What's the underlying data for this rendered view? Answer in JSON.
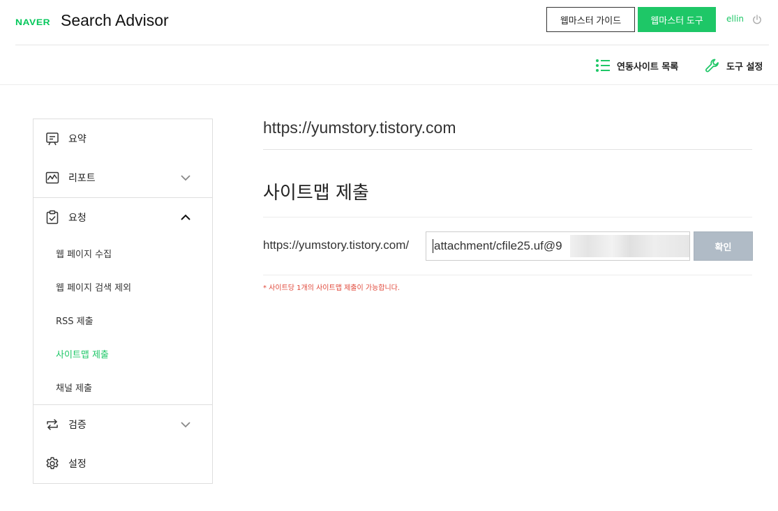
{
  "header": {
    "logo": "NAVER",
    "product": "Search Advisor",
    "guide_button": "웹마스터 가이드",
    "tools_button": "웹마스터 도구",
    "user": "ellin",
    "icons": [
      "power-icon"
    ]
  },
  "subnav": {
    "sites_link": "연동사이트 목록",
    "settings_link": "도구 설정",
    "icons": [
      "list-icon",
      "wrench-icon"
    ]
  },
  "sidebar": {
    "items": [
      {
        "label": "요약",
        "icon": "summary-icon"
      },
      {
        "label": "리포트",
        "icon": "report-chart-icon",
        "expanded": false
      },
      {
        "label": "요청",
        "icon": "clipboard-check-icon",
        "expanded": true
      },
      {
        "label": "검증",
        "icon": "repeat-arrows-icon",
        "expanded": false
      },
      {
        "label": "설정",
        "icon": "gear-icon"
      }
    ],
    "request_sub": [
      {
        "label": "웹 페이지 수집",
        "active": false
      },
      {
        "label": "웹 페이지 검색 제외",
        "active": false
      },
      {
        "label": "RSS 제출",
        "active": false
      },
      {
        "label": "사이트맵 제출",
        "active": true
      },
      {
        "label": "채널 제출",
        "active": false
      }
    ]
  },
  "main": {
    "site_url": "https://yumstory.tistory.com",
    "heading": "사이트맵 제출",
    "prefix": "https://yumstory.tistory.com/",
    "input_value": "attachment/cfile25.uf@9",
    "confirm_button": "확인",
    "notice": "* 사이트당 1개의 사이트맵 제출이 가능합니다."
  },
  "colors": {
    "accent": "#1ec767",
    "confirm_button": "#b0bbc6",
    "notice": "#e0483a"
  }
}
